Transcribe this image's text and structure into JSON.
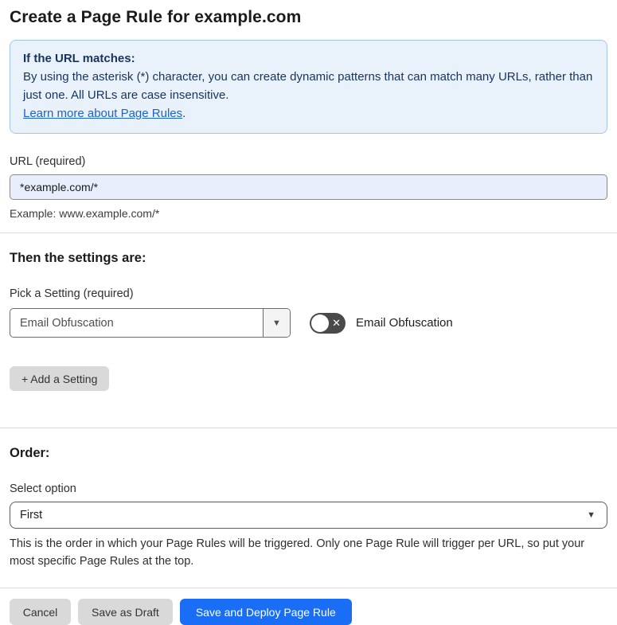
{
  "page": {
    "title": "Create a Page Rule for example.com"
  },
  "info_box": {
    "heading": "If the URL matches:",
    "body": "By using the asterisk (*) character, you can create dynamic patterns that can match many URLs, rather than just one. All URLs are case insensitive.",
    "link_label": "Learn more about Page Rules",
    "link_suffix": "."
  },
  "url_field": {
    "label": "URL (required)",
    "value": "*example.com/*",
    "helper": "Example: www.example.com/*"
  },
  "settings_section": {
    "heading": "Then the settings are:",
    "picker_label": "Pick a Setting (required)",
    "picker_value": "Email Obfuscation",
    "toggle_label": "Email Obfuscation",
    "toggle_state": "off",
    "add_button_label": "+ Add a Setting"
  },
  "order_section": {
    "heading": "Order:",
    "select_label": "Select option",
    "select_value": "First",
    "helper": "This is the order in which your Page Rules will be triggered. Only one Page Rule will trigger per URL, so put your most specific Page Rules at the top."
  },
  "footer": {
    "cancel_label": "Cancel",
    "save_draft_label": "Save as Draft",
    "save_deploy_label": "Save and Deploy Page Rule"
  },
  "icons": {
    "dropdown_arrow": "▼",
    "toggle_off_x": "✕"
  },
  "colors": {
    "accent_blue": "#1a6ef5",
    "info_bg": "#e9f1fb",
    "info_border": "#a3c6e8",
    "info_text": "#16355c",
    "link_blue": "#1b62d6",
    "input_autofill_bg": "#e8eefb",
    "button_gray": "#d9d9d9",
    "toggle_dark": "#4a4a4a"
  }
}
